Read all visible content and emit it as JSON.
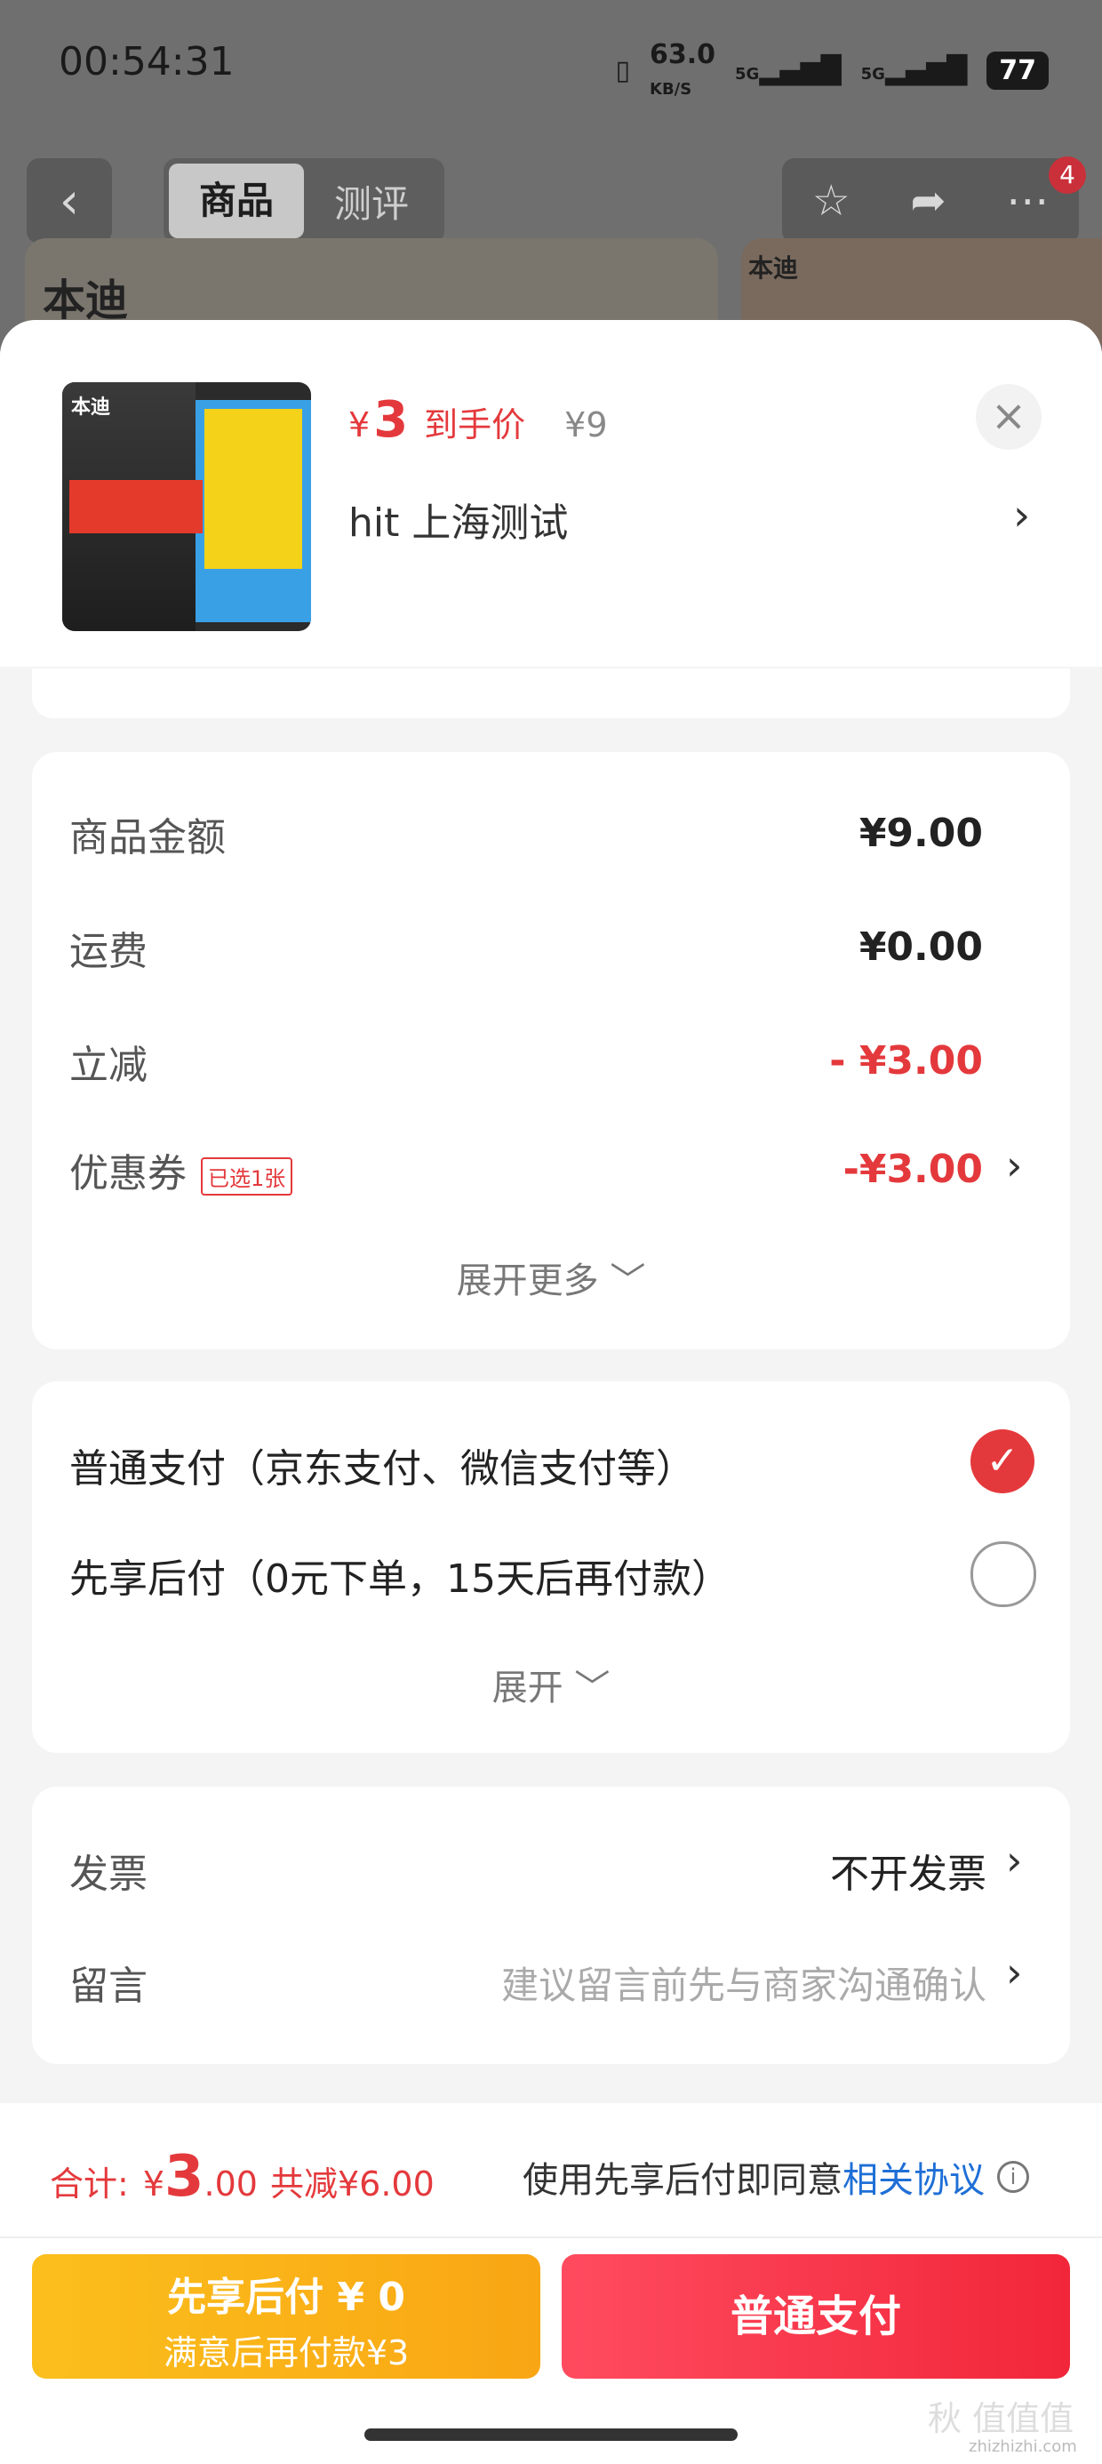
{
  "status_bar": {
    "time": "00:54:31",
    "speed": "63.0",
    "speed_unit": "KB/S",
    "net1": "5G",
    "net2": "5G",
    "battery": "77"
  },
  "product_nav": {
    "tab_goods": "商品",
    "tab_review": "测评",
    "notif_count": "4",
    "bg_logo": "本迪",
    "bg_logo2": "本迪"
  },
  "product": {
    "thumb_brand": "本迪",
    "currency": "¥",
    "final_price": "3",
    "final_label": "到手价",
    "orig_price": "¥9",
    "address": "hit 上海测试"
  },
  "costs": {
    "goods_amount_label": "商品金额",
    "goods_amount": "¥9.00",
    "shipping_label": "运费",
    "shipping": "¥0.00",
    "discount_label": "立减",
    "discount": "- ¥3.00",
    "coupon_label": "优惠券",
    "coupon_chip": "已选1张",
    "coupon": "-¥3.00",
    "expand_more": "展开更多 ﹀"
  },
  "payment": {
    "normal_label": "普通支付（京东支付、微信支付等）",
    "later_label": "先享后付（0元下单，15天后再付款）",
    "expand": "展开 ﹀"
  },
  "extras": {
    "invoice_label": "发票",
    "invoice_value": "不开发票",
    "message_label": "留言",
    "message_placeholder": "建议留言前先与商家沟通确认"
  },
  "footer": {
    "total_label": "合计:",
    "total_currency": "¥",
    "total_big": "3",
    "total_small": ".00",
    "total_saved": "共减¥6.00",
    "agree_text": "使用先享后付即同意",
    "agree_link": "相关协议",
    "later_btn_line1": "先享后付 ¥ 0",
    "later_btn_line2": "满意后再付款¥3",
    "pay_btn": "普通支付",
    "watermark": "秋 值值值",
    "watermark_small": "zhizhizhi.com"
  },
  "colors": {
    "accent": "#e4393c",
    "link": "#1f6fd6",
    "later_btn": "#fbbf1c"
  }
}
